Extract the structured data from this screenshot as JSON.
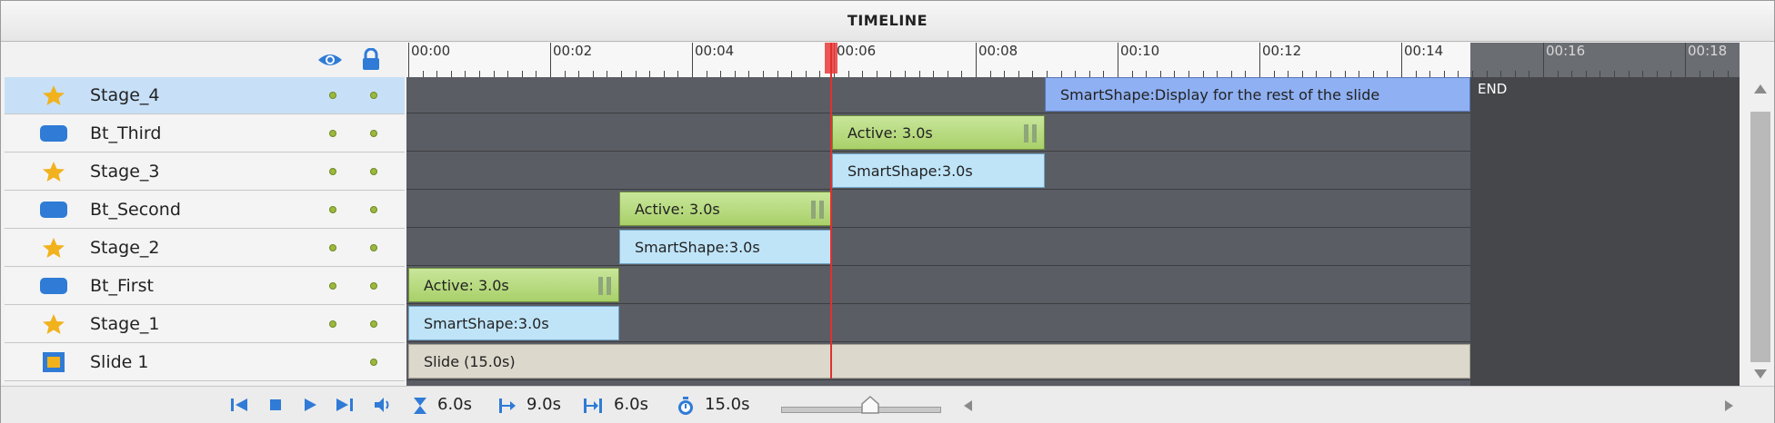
{
  "panel": {
    "title": "TIMELINE"
  },
  "layers": [
    {
      "name": "Stage_4",
      "icon": "star-icon",
      "selected": true
    },
    {
      "name": "Bt_Third",
      "icon": "button-icon",
      "selected": false
    },
    {
      "name": "Stage_3",
      "icon": "star-icon",
      "selected": false
    },
    {
      "name": "Bt_Second",
      "icon": "button-icon",
      "selected": false
    },
    {
      "name": "Stage_2",
      "icon": "star-icon",
      "selected": false
    },
    {
      "name": "Bt_First",
      "icon": "button-icon",
      "selected": false
    },
    {
      "name": "Stage_1",
      "icon": "star-icon",
      "selected": false
    },
    {
      "name": "Slide 1",
      "icon": "slide-icon",
      "selected": false
    }
  ],
  "ruler": {
    "labels": [
      "00:00",
      "00:02",
      "00:04",
      "00:06",
      "00:08",
      "00:10",
      "00:12",
      "00:14",
      "00:16",
      "00:18"
    ]
  },
  "timeline_items": {
    "stage4": "SmartShape:Display for the rest of the slide",
    "bt_third": "Active: 3.0s",
    "stage3": "SmartShape:3.0s",
    "bt_second": "Active: 3.0s",
    "stage2": "SmartShape:3.0s",
    "bt_first": "Active: 3.0s",
    "stage1": "SmartShape:3.0s",
    "slide": "Slide (15.0s)",
    "end": "END"
  },
  "status": {
    "current_time": "6.0s",
    "start_time": "9.0s",
    "duration": "6.0s",
    "slide_duration": "15.0s"
  },
  "colors": {
    "active_item": "#b6dc7e",
    "smartshape_item": "#bfe4f8",
    "selected_smartshape": "#8fb0f2",
    "playhead": "#e03030",
    "track_bg": "#5a5d63",
    "selected_row": "#c7e0f8",
    "star": "#f1b21d",
    "button_icon": "#2f7bd6"
  }
}
